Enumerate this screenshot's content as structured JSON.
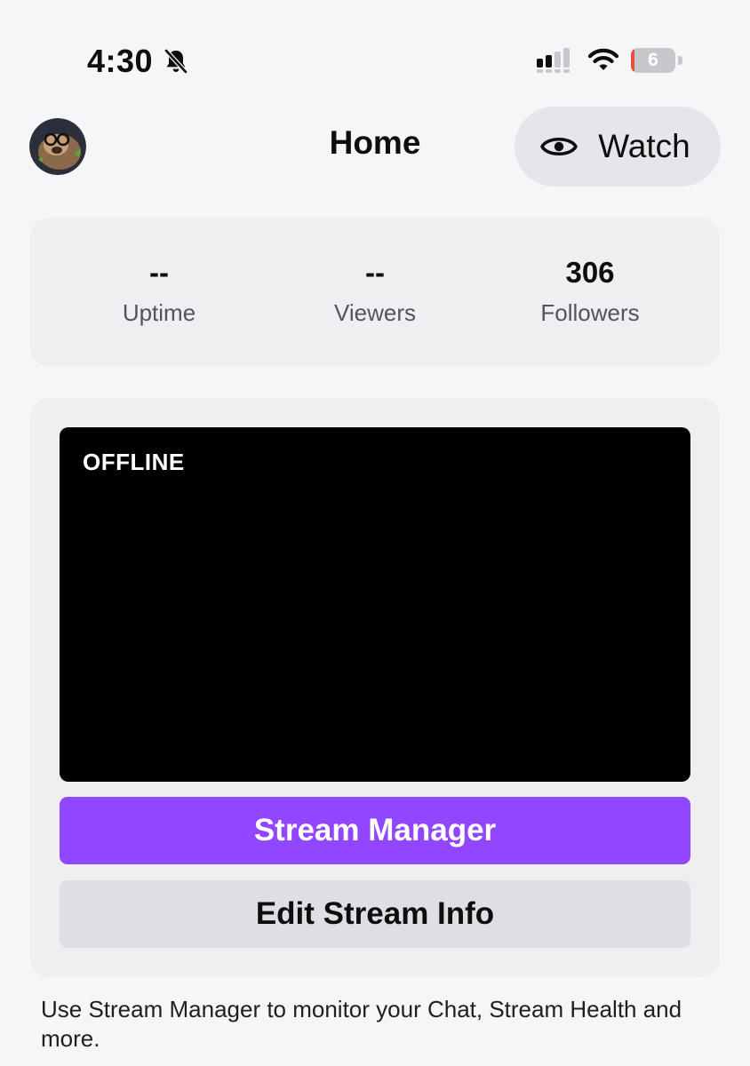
{
  "status_bar": {
    "time": "4:30",
    "battery_percent": "6",
    "battery_level": 0.06,
    "icons": [
      "bell-slash-icon",
      "cellular-signal-icon",
      "wifi-icon",
      "battery-icon"
    ]
  },
  "header": {
    "title": "Home",
    "watch_label": "Watch",
    "watch_icon": "eye-icon"
  },
  "stats": [
    {
      "value": "--",
      "label": "Uptime"
    },
    {
      "value": "--",
      "label": "Viewers"
    },
    {
      "value": "306",
      "label": "Followers"
    }
  ],
  "stream": {
    "status": "OFFLINE",
    "primary_button": "Stream Manager",
    "secondary_button": "Edit Stream Info"
  },
  "footer_text": "Use Stream Manager to monitor your Chat, Stream Health and more.",
  "colors": {
    "accent": "#9147ff",
    "background": "#f6f6f8",
    "card": "#efeff1",
    "battery_low": "#eb4d3d"
  }
}
